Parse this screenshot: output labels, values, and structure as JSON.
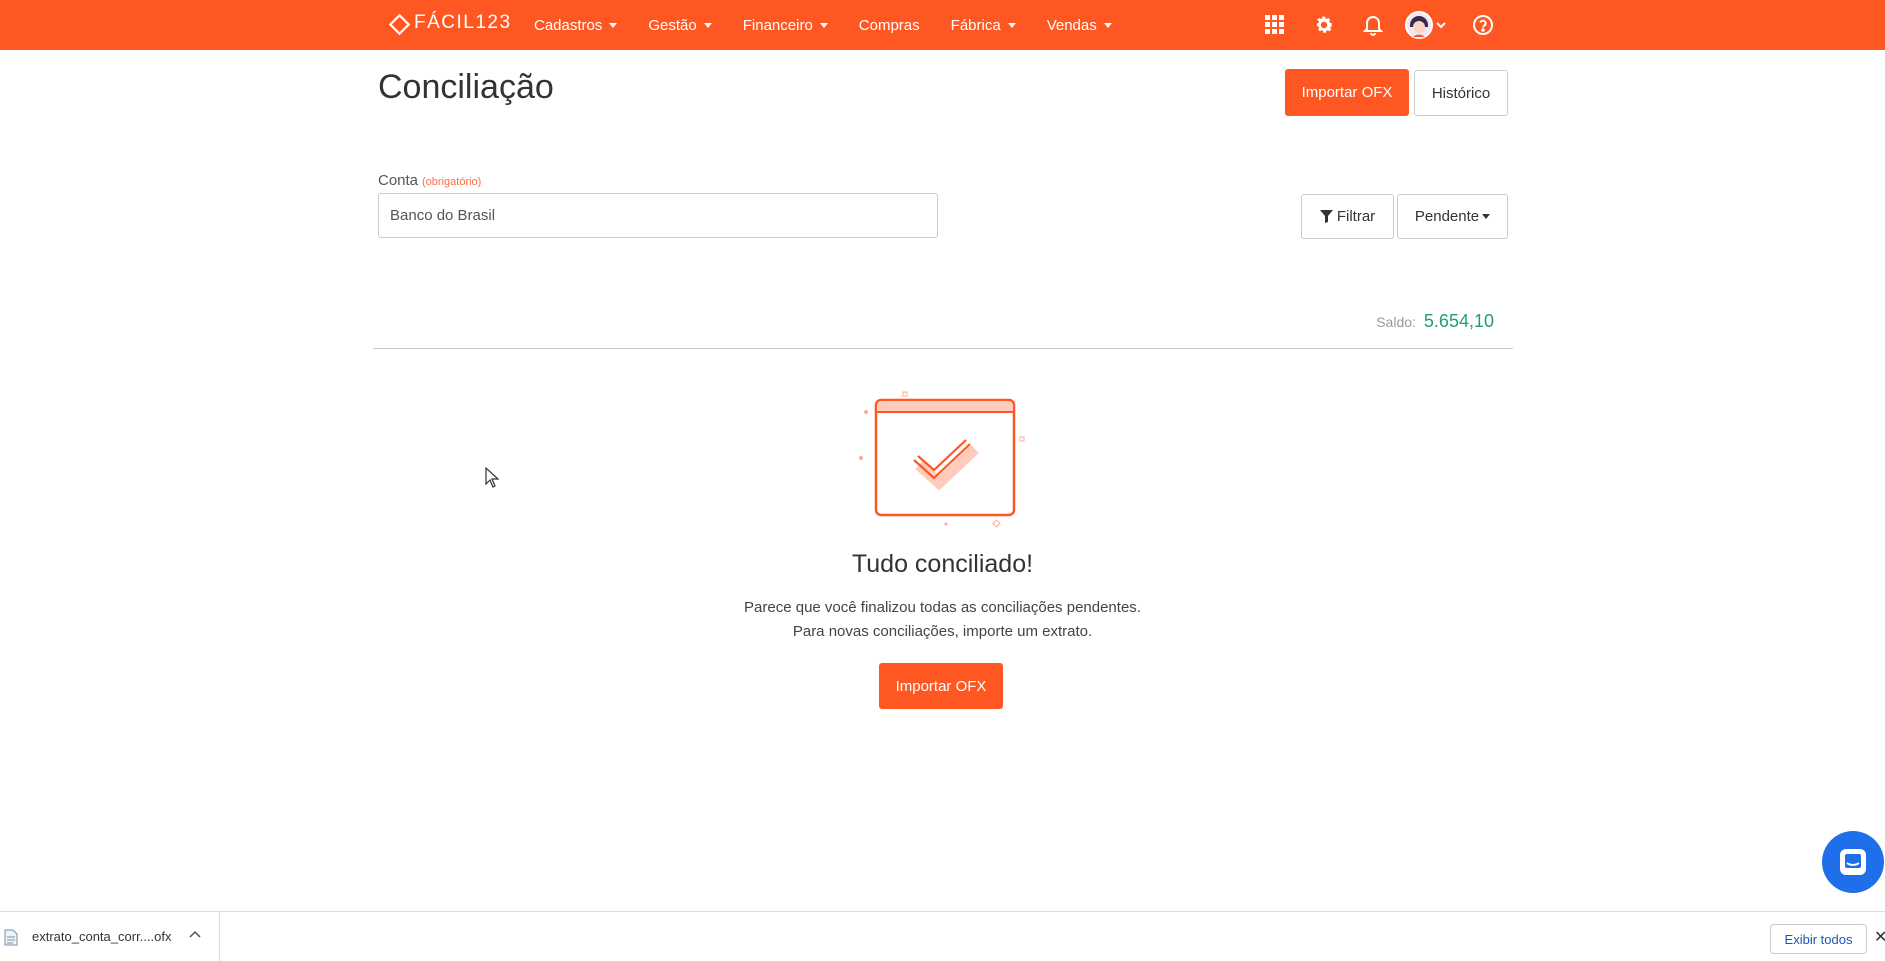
{
  "app": {
    "logo_text": "FÁCIL123"
  },
  "nav": {
    "items": [
      {
        "label": "Cadastros",
        "dropdown": true
      },
      {
        "label": "Gestão",
        "dropdown": true
      },
      {
        "label": "Financeiro",
        "dropdown": true
      },
      {
        "label": "Compras",
        "dropdown": false
      },
      {
        "label": "Fábrica",
        "dropdown": true
      },
      {
        "label": "Vendas",
        "dropdown": true
      }
    ],
    "right_icons": [
      "apps-grid-icon",
      "gear-icon",
      "bell-icon",
      "user-avatar",
      "help-icon"
    ]
  },
  "page": {
    "title": "Conciliação",
    "import_button": "Importar OFX",
    "history_button": "Histórico"
  },
  "account": {
    "label": "Conta",
    "required_hint": "(obrigatório)",
    "value": "Banco do Brasil"
  },
  "filters": {
    "filter_button": "Filtrar",
    "status_select": "Pendente"
  },
  "balance": {
    "label": "Saldo:",
    "value": "5.654,10"
  },
  "empty_state": {
    "title": "Tudo conciliado!",
    "line1": "Parece que você finalizou todas as conciliações pendentes.",
    "line2": "Para novas conciliações, importe um extrato.",
    "button": "Importar OFX"
  },
  "download_bar": {
    "file_name": "extrato_conta_corr....ofx",
    "show_all": "Exibir todos"
  },
  "colors": {
    "brand": "#ff5722",
    "balance_positive": "#22a06b",
    "chat": "#1f6feb"
  }
}
